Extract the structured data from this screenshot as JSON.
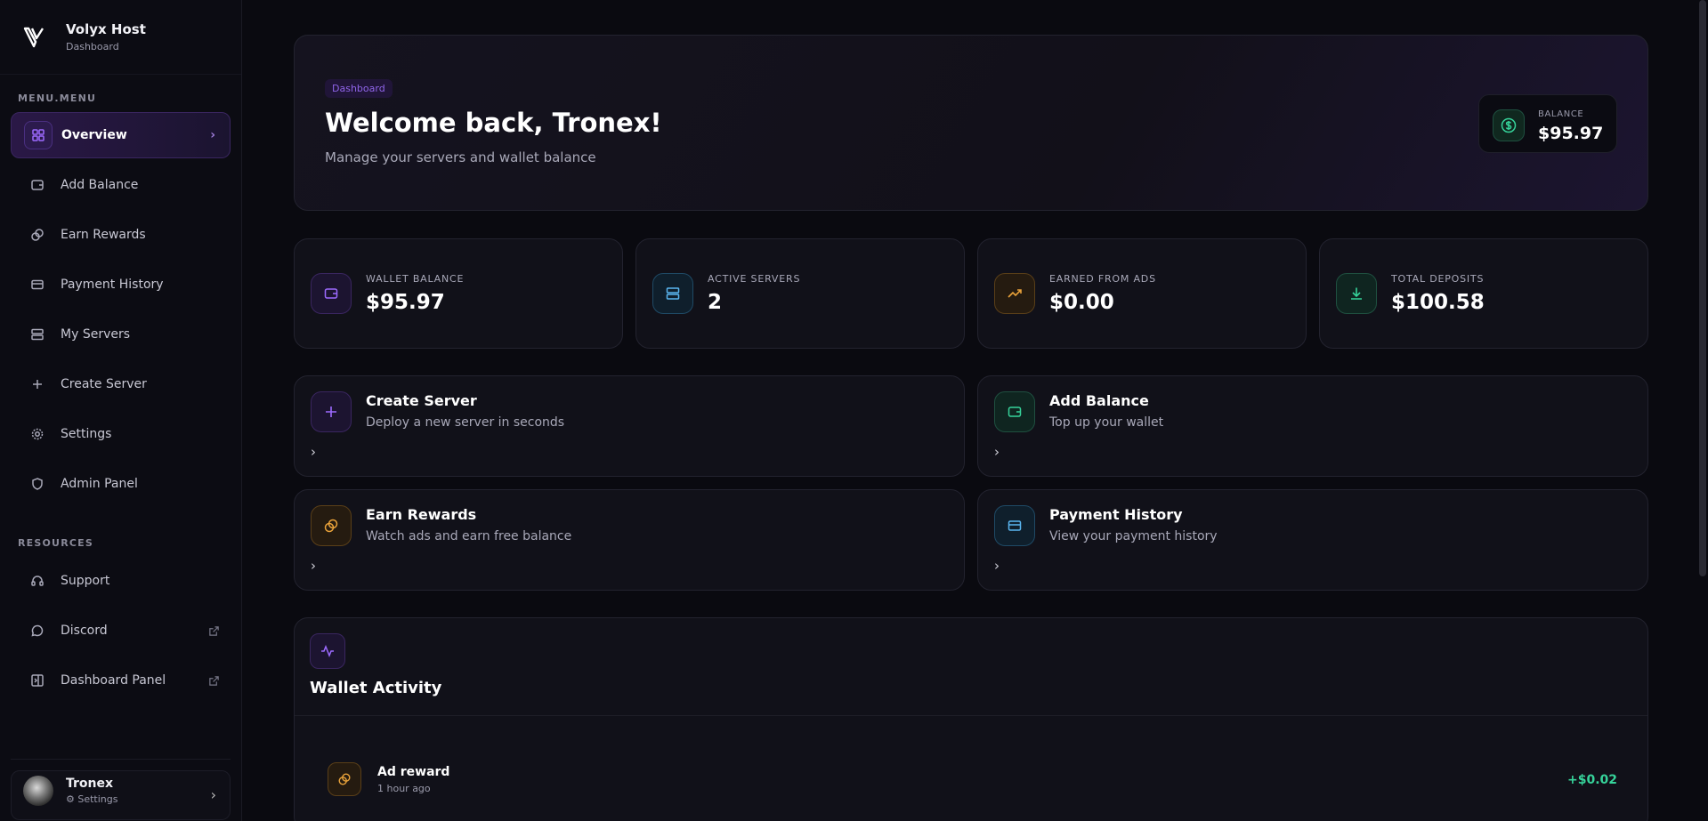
{
  "brand": {
    "title": "Volyx Host",
    "subtitle": "Dashboard"
  },
  "sidebar": {
    "menu_label": "MENU.MENU",
    "items": [
      {
        "label": "Overview",
        "icon": "grid-icon",
        "active": true
      },
      {
        "label": "Add Balance",
        "icon": "wallet-icon"
      },
      {
        "label": "Earn Rewards",
        "icon": "coins-icon"
      },
      {
        "label": "Payment History",
        "icon": "credit-card-icon"
      },
      {
        "label": "My Servers",
        "icon": "server-icon"
      },
      {
        "label": "Create Server",
        "icon": "plus-icon"
      },
      {
        "label": "Settings",
        "icon": "gear-icon"
      },
      {
        "label": "Admin Panel",
        "icon": "shield-icon"
      }
    ],
    "resources_label": "RESOURCES",
    "resources": [
      {
        "label": "Support",
        "icon": "headset-icon"
      },
      {
        "label": "Discord",
        "icon": "chat-icon",
        "external": true
      },
      {
        "label": "Dashboard Panel",
        "icon": "panel-icon",
        "external": true
      }
    ]
  },
  "user": {
    "name": "Tronex",
    "settings_label": "Settings"
  },
  "hero": {
    "chip": "Dashboard",
    "title": "Welcome back, Tronex!",
    "subtitle": "Manage your servers and wallet balance",
    "balance_label": "BALANCE",
    "balance_value": "$95.97"
  },
  "stats": [
    {
      "label": "WALLET BALANCE",
      "value": "$95.97",
      "icon": "wallet-icon",
      "color": "#9d6bff"
    },
    {
      "label": "ACTIVE SERVERS",
      "value": "2",
      "icon": "server-icon",
      "color": "#5ab6f0"
    },
    {
      "label": "EARNED FROM ADS",
      "value": "$0.00",
      "icon": "trending-up-icon",
      "color": "#e9a23a"
    },
    {
      "label": "TOTAL DEPOSITS",
      "value": "$100.58",
      "icon": "download-icon",
      "color": "#36d39a"
    }
  ],
  "actions": [
    {
      "title": "Create Server",
      "desc": "Deploy a new server in seconds",
      "icon": "plus-icon"
    },
    {
      "title": "Add Balance",
      "desc": "Top up your wallet",
      "icon": "wallet-icon"
    },
    {
      "title": "Earn Rewards",
      "desc": "Watch ads and earn free balance",
      "icon": "coins-icon"
    },
    {
      "title": "Payment History",
      "desc": "View your payment history",
      "icon": "credit-card-icon"
    }
  ],
  "activity": {
    "title": "Wallet Activity",
    "rows": [
      {
        "title": "Ad reward",
        "time": "1 hour ago",
        "amount": "+$0.02",
        "icon": "coins-icon"
      }
    ]
  }
}
